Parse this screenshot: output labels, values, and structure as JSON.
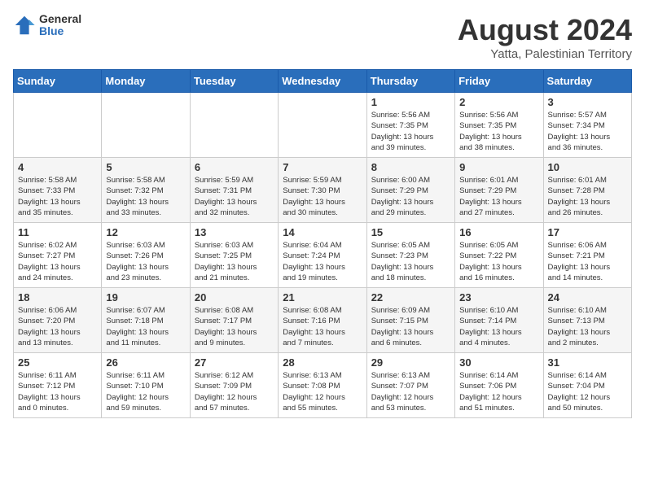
{
  "header": {
    "logo": {
      "general": "General",
      "blue": "Blue"
    },
    "title": "August 2024",
    "location": "Yatta, Palestinian Territory"
  },
  "weekdays": [
    "Sunday",
    "Monday",
    "Tuesday",
    "Wednesday",
    "Thursday",
    "Friday",
    "Saturday"
  ],
  "weeks": [
    [
      {
        "day": "",
        "info": ""
      },
      {
        "day": "",
        "info": ""
      },
      {
        "day": "",
        "info": ""
      },
      {
        "day": "",
        "info": ""
      },
      {
        "day": "1",
        "info": "Sunrise: 5:56 AM\nSunset: 7:35 PM\nDaylight: 13 hours\nand 39 minutes."
      },
      {
        "day": "2",
        "info": "Sunrise: 5:56 AM\nSunset: 7:35 PM\nDaylight: 13 hours\nand 38 minutes."
      },
      {
        "day": "3",
        "info": "Sunrise: 5:57 AM\nSunset: 7:34 PM\nDaylight: 13 hours\nand 36 minutes."
      }
    ],
    [
      {
        "day": "4",
        "info": "Sunrise: 5:58 AM\nSunset: 7:33 PM\nDaylight: 13 hours\nand 35 minutes."
      },
      {
        "day": "5",
        "info": "Sunrise: 5:58 AM\nSunset: 7:32 PM\nDaylight: 13 hours\nand 33 minutes."
      },
      {
        "day": "6",
        "info": "Sunrise: 5:59 AM\nSunset: 7:31 PM\nDaylight: 13 hours\nand 32 minutes."
      },
      {
        "day": "7",
        "info": "Sunrise: 5:59 AM\nSunset: 7:30 PM\nDaylight: 13 hours\nand 30 minutes."
      },
      {
        "day": "8",
        "info": "Sunrise: 6:00 AM\nSunset: 7:29 PM\nDaylight: 13 hours\nand 29 minutes."
      },
      {
        "day": "9",
        "info": "Sunrise: 6:01 AM\nSunset: 7:29 PM\nDaylight: 13 hours\nand 27 minutes."
      },
      {
        "day": "10",
        "info": "Sunrise: 6:01 AM\nSunset: 7:28 PM\nDaylight: 13 hours\nand 26 minutes."
      }
    ],
    [
      {
        "day": "11",
        "info": "Sunrise: 6:02 AM\nSunset: 7:27 PM\nDaylight: 13 hours\nand 24 minutes."
      },
      {
        "day": "12",
        "info": "Sunrise: 6:03 AM\nSunset: 7:26 PM\nDaylight: 13 hours\nand 23 minutes."
      },
      {
        "day": "13",
        "info": "Sunrise: 6:03 AM\nSunset: 7:25 PM\nDaylight: 13 hours\nand 21 minutes."
      },
      {
        "day": "14",
        "info": "Sunrise: 6:04 AM\nSunset: 7:24 PM\nDaylight: 13 hours\nand 19 minutes."
      },
      {
        "day": "15",
        "info": "Sunrise: 6:05 AM\nSunset: 7:23 PM\nDaylight: 13 hours\nand 18 minutes."
      },
      {
        "day": "16",
        "info": "Sunrise: 6:05 AM\nSunset: 7:22 PM\nDaylight: 13 hours\nand 16 minutes."
      },
      {
        "day": "17",
        "info": "Sunrise: 6:06 AM\nSunset: 7:21 PM\nDaylight: 13 hours\nand 14 minutes."
      }
    ],
    [
      {
        "day": "18",
        "info": "Sunrise: 6:06 AM\nSunset: 7:20 PM\nDaylight: 13 hours\nand 13 minutes."
      },
      {
        "day": "19",
        "info": "Sunrise: 6:07 AM\nSunset: 7:18 PM\nDaylight: 13 hours\nand 11 minutes."
      },
      {
        "day": "20",
        "info": "Sunrise: 6:08 AM\nSunset: 7:17 PM\nDaylight: 13 hours\nand 9 minutes."
      },
      {
        "day": "21",
        "info": "Sunrise: 6:08 AM\nSunset: 7:16 PM\nDaylight: 13 hours\nand 7 minutes."
      },
      {
        "day": "22",
        "info": "Sunrise: 6:09 AM\nSunset: 7:15 PM\nDaylight: 13 hours\nand 6 minutes."
      },
      {
        "day": "23",
        "info": "Sunrise: 6:10 AM\nSunset: 7:14 PM\nDaylight: 13 hours\nand 4 minutes."
      },
      {
        "day": "24",
        "info": "Sunrise: 6:10 AM\nSunset: 7:13 PM\nDaylight: 13 hours\nand 2 minutes."
      }
    ],
    [
      {
        "day": "25",
        "info": "Sunrise: 6:11 AM\nSunset: 7:12 PM\nDaylight: 13 hours\nand 0 minutes."
      },
      {
        "day": "26",
        "info": "Sunrise: 6:11 AM\nSunset: 7:10 PM\nDaylight: 12 hours\nand 59 minutes."
      },
      {
        "day": "27",
        "info": "Sunrise: 6:12 AM\nSunset: 7:09 PM\nDaylight: 12 hours\nand 57 minutes."
      },
      {
        "day": "28",
        "info": "Sunrise: 6:13 AM\nSunset: 7:08 PM\nDaylight: 12 hours\nand 55 minutes."
      },
      {
        "day": "29",
        "info": "Sunrise: 6:13 AM\nSunset: 7:07 PM\nDaylight: 12 hours\nand 53 minutes."
      },
      {
        "day": "30",
        "info": "Sunrise: 6:14 AM\nSunset: 7:06 PM\nDaylight: 12 hours\nand 51 minutes."
      },
      {
        "day": "31",
        "info": "Sunrise: 6:14 AM\nSunset: 7:04 PM\nDaylight: 12 hours\nand 50 minutes."
      }
    ]
  ]
}
